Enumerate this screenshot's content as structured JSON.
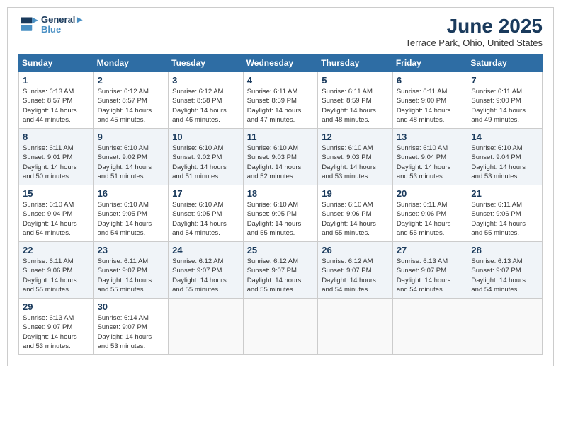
{
  "logo": {
    "line1": "General",
    "line2": "Blue"
  },
  "title": "June 2025",
  "location": "Terrace Park, Ohio, United States",
  "days_of_week": [
    "Sunday",
    "Monday",
    "Tuesday",
    "Wednesday",
    "Thursday",
    "Friday",
    "Saturday"
  ],
  "weeks": [
    [
      {
        "day": "1",
        "sunrise": "6:13 AM",
        "sunset": "8:57 PM",
        "daylight": "14 hours and 44 minutes."
      },
      {
        "day": "2",
        "sunrise": "6:12 AM",
        "sunset": "8:57 PM",
        "daylight": "14 hours and 45 minutes."
      },
      {
        "day": "3",
        "sunrise": "6:12 AM",
        "sunset": "8:58 PM",
        "daylight": "14 hours and 46 minutes."
      },
      {
        "day": "4",
        "sunrise": "6:11 AM",
        "sunset": "8:59 PM",
        "daylight": "14 hours and 47 minutes."
      },
      {
        "day": "5",
        "sunrise": "6:11 AM",
        "sunset": "8:59 PM",
        "daylight": "14 hours and 48 minutes."
      },
      {
        "day": "6",
        "sunrise": "6:11 AM",
        "sunset": "9:00 PM",
        "daylight": "14 hours and 48 minutes."
      },
      {
        "day": "7",
        "sunrise": "6:11 AM",
        "sunset": "9:00 PM",
        "daylight": "14 hours and 49 minutes."
      }
    ],
    [
      {
        "day": "8",
        "sunrise": "6:11 AM",
        "sunset": "9:01 PM",
        "daylight": "14 hours and 50 minutes."
      },
      {
        "day": "9",
        "sunrise": "6:10 AM",
        "sunset": "9:02 PM",
        "daylight": "14 hours and 51 minutes."
      },
      {
        "day": "10",
        "sunrise": "6:10 AM",
        "sunset": "9:02 PM",
        "daylight": "14 hours and 51 minutes."
      },
      {
        "day": "11",
        "sunrise": "6:10 AM",
        "sunset": "9:03 PM",
        "daylight": "14 hours and 52 minutes."
      },
      {
        "day": "12",
        "sunrise": "6:10 AM",
        "sunset": "9:03 PM",
        "daylight": "14 hours and 53 minutes."
      },
      {
        "day": "13",
        "sunrise": "6:10 AM",
        "sunset": "9:04 PM",
        "daylight": "14 hours and 53 minutes."
      },
      {
        "day": "14",
        "sunrise": "6:10 AM",
        "sunset": "9:04 PM",
        "daylight": "14 hours and 53 minutes."
      }
    ],
    [
      {
        "day": "15",
        "sunrise": "6:10 AM",
        "sunset": "9:04 PM",
        "daylight": "14 hours and 54 minutes."
      },
      {
        "day": "16",
        "sunrise": "6:10 AM",
        "sunset": "9:05 PM",
        "daylight": "14 hours and 54 minutes."
      },
      {
        "day": "17",
        "sunrise": "6:10 AM",
        "sunset": "9:05 PM",
        "daylight": "14 hours and 54 minutes."
      },
      {
        "day": "18",
        "sunrise": "6:10 AM",
        "sunset": "9:05 PM",
        "daylight": "14 hours and 55 minutes."
      },
      {
        "day": "19",
        "sunrise": "6:10 AM",
        "sunset": "9:06 PM",
        "daylight": "14 hours and 55 minutes."
      },
      {
        "day": "20",
        "sunrise": "6:11 AM",
        "sunset": "9:06 PM",
        "daylight": "14 hours and 55 minutes."
      },
      {
        "day": "21",
        "sunrise": "6:11 AM",
        "sunset": "9:06 PM",
        "daylight": "14 hours and 55 minutes."
      }
    ],
    [
      {
        "day": "22",
        "sunrise": "6:11 AM",
        "sunset": "9:06 PM",
        "daylight": "14 hours and 55 minutes."
      },
      {
        "day": "23",
        "sunrise": "6:11 AM",
        "sunset": "9:07 PM",
        "daylight": "14 hours and 55 minutes."
      },
      {
        "day": "24",
        "sunrise": "6:12 AM",
        "sunset": "9:07 PM",
        "daylight": "14 hours and 55 minutes."
      },
      {
        "day": "25",
        "sunrise": "6:12 AM",
        "sunset": "9:07 PM",
        "daylight": "14 hours and 55 minutes."
      },
      {
        "day": "26",
        "sunrise": "6:12 AM",
        "sunset": "9:07 PM",
        "daylight": "14 hours and 54 minutes."
      },
      {
        "day": "27",
        "sunrise": "6:13 AM",
        "sunset": "9:07 PM",
        "daylight": "14 hours and 54 minutes."
      },
      {
        "day": "28",
        "sunrise": "6:13 AM",
        "sunset": "9:07 PM",
        "daylight": "14 hours and 54 minutes."
      }
    ],
    [
      {
        "day": "29",
        "sunrise": "6:13 AM",
        "sunset": "9:07 PM",
        "daylight": "14 hours and 53 minutes."
      },
      {
        "day": "30",
        "sunrise": "6:14 AM",
        "sunset": "9:07 PM",
        "daylight": "14 hours and 53 minutes."
      },
      null,
      null,
      null,
      null,
      null
    ]
  ]
}
